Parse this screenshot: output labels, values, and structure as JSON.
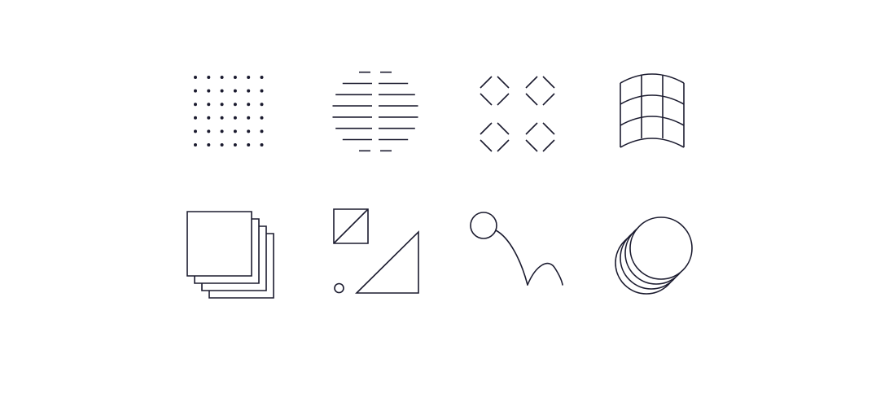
{
  "theme": {
    "background": "#ffffff",
    "stroke": "#1b1b2f"
  },
  "icons": [
    {
      "id": "dot-grid",
      "icon": "dot-grid-icon",
      "row": 1,
      "column": 1
    },
    {
      "id": "striped-circle",
      "icon": "striped-circle-icon",
      "row": 1,
      "column": 2
    },
    {
      "id": "diamond-lattice",
      "icon": "diamond-lattice-icon",
      "row": 1,
      "column": 3
    },
    {
      "id": "curved-grid",
      "icon": "curved-grid-icon",
      "row": 1,
      "column": 4
    },
    {
      "id": "stacked-squares",
      "icon": "stacked-squares-icon",
      "row": 2,
      "column": 1
    },
    {
      "id": "triangles-and-circle",
      "icon": "triangles-circle-icon",
      "row": 2,
      "column": 2
    },
    {
      "id": "bouncing-ball",
      "icon": "bouncing-ball-icon",
      "row": 2,
      "column": 3
    },
    {
      "id": "stacked-circles",
      "icon": "stacked-circles-icon",
      "row": 2,
      "column": 4
    }
  ]
}
